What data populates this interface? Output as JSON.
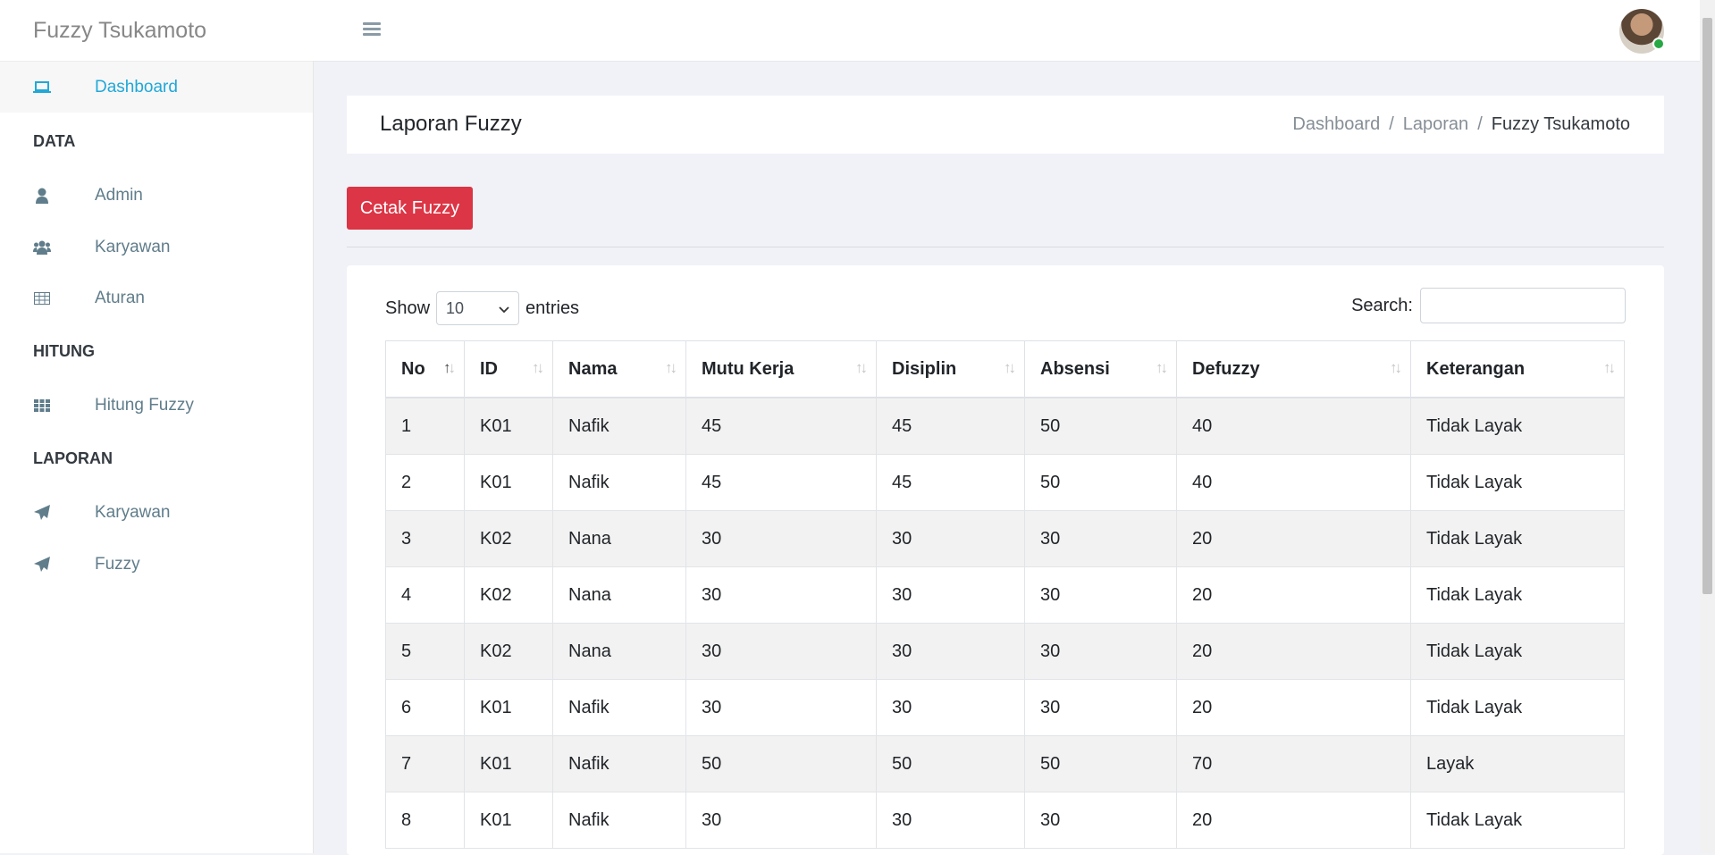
{
  "brand": "Fuzzy Tsukamoto",
  "sidebar": {
    "dashboard": "Dashboard",
    "sections": [
      {
        "title": "DATA"
      },
      {
        "title": "HITUNG"
      },
      {
        "title": "LAPORAN"
      }
    ],
    "items": [
      {
        "label": "Admin",
        "icon": "user-icon"
      },
      {
        "label": "Karyawan",
        "icon": "users-icon"
      },
      {
        "label": "Aturan",
        "icon": "table-icon"
      },
      {
        "label": "Hitung Fuzzy",
        "icon": "grid-icon"
      },
      {
        "label": "Karyawan",
        "icon": "paper-plane-icon"
      },
      {
        "label": "Fuzzy",
        "icon": "paper-plane-icon"
      }
    ]
  },
  "header": {
    "title": "Laporan Fuzzy",
    "breadcrumb": [
      "Dashboard",
      "/",
      "Laporan",
      "/",
      "Fuzzy Tsukamoto"
    ]
  },
  "actions": {
    "print_label": "Cetak Fuzzy"
  },
  "table_controls": {
    "show_label": "Show",
    "entries_value": "10",
    "entries_label": "entries",
    "search_label": "Search:"
  },
  "table": {
    "columns": [
      "No",
      "ID",
      "Nama",
      "Mutu Kerja",
      "Disiplin",
      "Absensi",
      "Defuzzy",
      "Keterangan"
    ],
    "rows": [
      [
        "1",
        "K01",
        "Nafik",
        "45",
        "45",
        "50",
        "40",
        "Tidak Layak"
      ],
      [
        "2",
        "K01",
        "Nafik",
        "45",
        "45",
        "50",
        "40",
        "Tidak Layak"
      ],
      [
        "3",
        "K02",
        "Nana",
        "30",
        "30",
        "30",
        "20",
        "Tidak Layak"
      ],
      [
        "4",
        "K02",
        "Nana",
        "30",
        "30",
        "30",
        "20",
        "Tidak Layak"
      ],
      [
        "5",
        "K02",
        "Nana",
        "30",
        "30",
        "30",
        "20",
        "Tidak Layak"
      ],
      [
        "6",
        "K01",
        "Nafik",
        "30",
        "30",
        "30",
        "20",
        "Tidak Layak"
      ],
      [
        "7",
        "K01",
        "Nafik",
        "50",
        "50",
        "50",
        "70",
        "Layak"
      ],
      [
        "8",
        "K01",
        "Nafik",
        "30",
        "30",
        "30",
        "20",
        "Tidak Layak"
      ]
    ]
  },
  "colors": {
    "accent": "#20a8d8",
    "danger": "#dc3545",
    "status_online": "#28a745"
  }
}
